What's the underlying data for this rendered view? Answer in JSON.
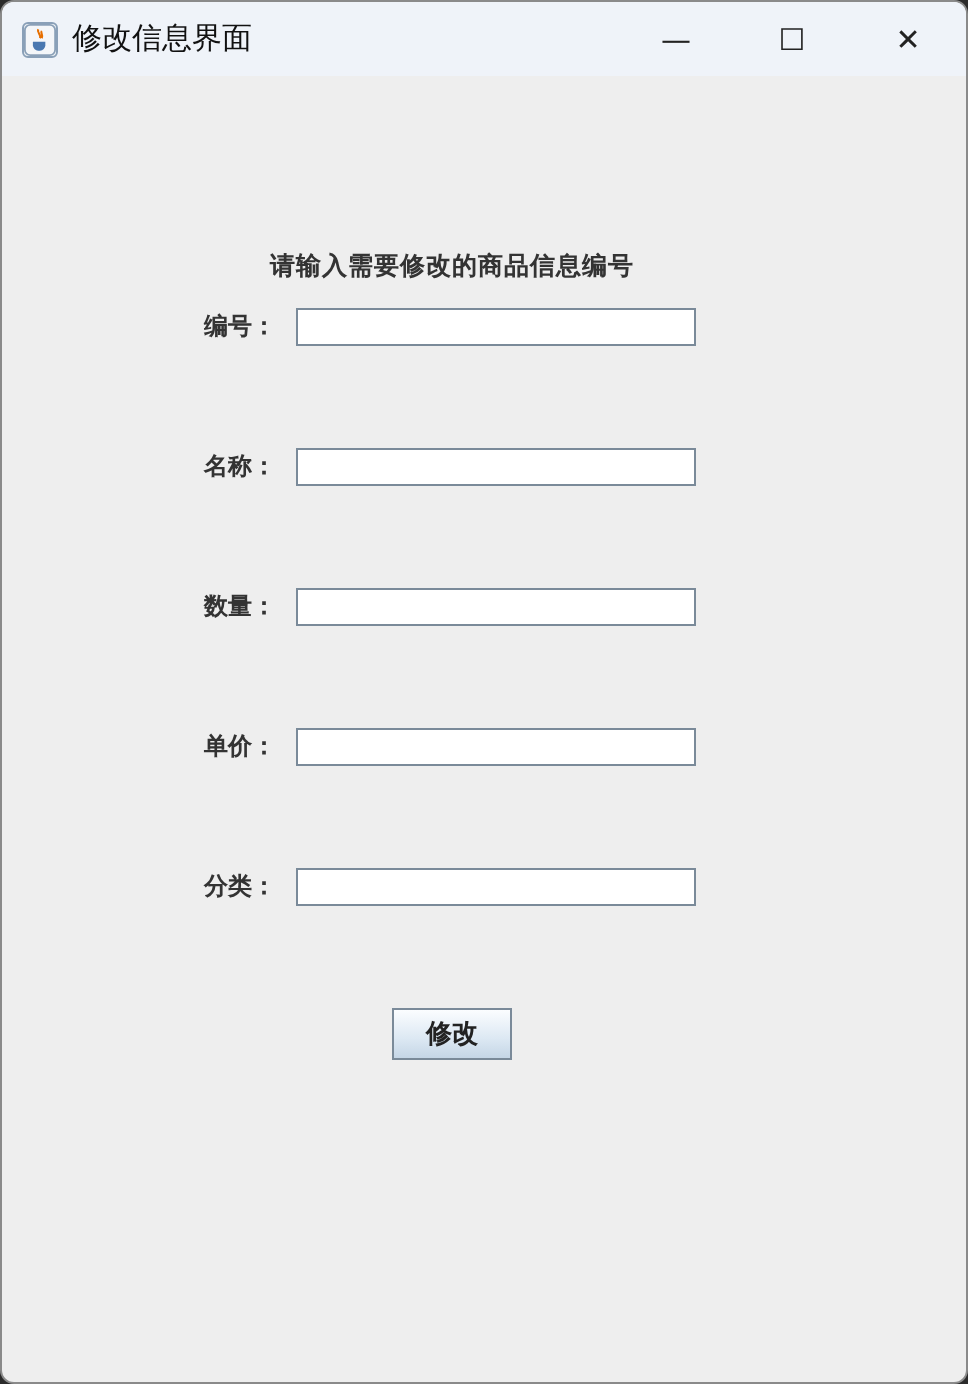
{
  "window": {
    "title": "修改信息界面",
    "controls": [
      "—",
      "☐",
      "✕"
    ]
  },
  "form": {
    "heading": "请输入需要修改的商品信息编号",
    "fields": [
      {
        "label": "编号："
      },
      {
        "label": "名称："
      },
      {
        "label": "数量："
      },
      {
        "label": "单价："
      },
      {
        "label": "分类："
      }
    ],
    "button": "修改"
  }
}
